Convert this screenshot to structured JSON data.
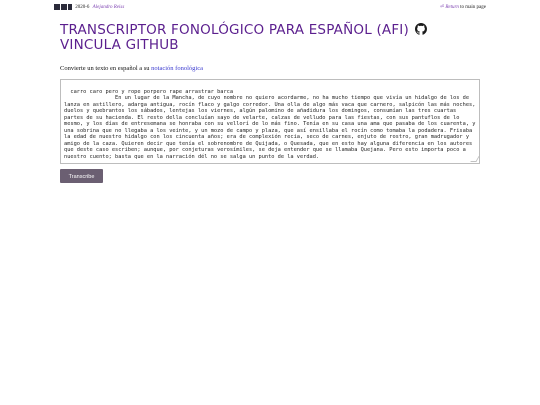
{
  "topbar": {
    "year": "2020-6",
    "author": "Alejandro Reiss",
    "back_arrow": "⏎",
    "back_label": "Return",
    "back_tail": "to main page"
  },
  "header": {
    "title": "Transcriptor fonológico para español (AFI)",
    "link_label": "vincula github"
  },
  "intro": {
    "text": "Convierte un texto en español a su",
    "link": "notación fonológica"
  },
  "input": {
    "value": "carro caro pero y rope porpero rape arrastrar barca\n                En un lugar de la Mancha, de cuyo nombre no quiero acordarme, no ha mucho tiempo que vivía un hidalgo de los de lanza en astillero, adarga antigua, rocín flaco y galgo corredor. Una olla de algo más vaca que carnero, salpicón las más noches, duelos y quebrantos los sábados, lentejas los viernes, algún palomino de añadidura los domingos, consumían las tres cuartas partes de su hacienda. El resto della concluían sayo de velarte, calzas de velludo para las fiestas, con sus pantuflos de lo mesmo, y los días de entresemana se honraba con su vellorí de lo más fino. Tenía en su casa una ama que pasaba de los cuarenta, y una sobrina que no llegaba a los veinte, y un mozo de campo y plaza, que así ensillaba el rocín como tomaba la podadera. Frisaba la edad de nuestro hidalgo con los cincuenta años; era de complexión recia, seco de carnes, enjuto de rostro, gran madrugador y amigo de la caza. Quieren decir que tenía el sobrenombre de Quijada, o Quesada, que en esto hay alguna diferencia en los autores que deste caso escriben; aunque, por conjeturas verosímiles, se deja entender que se llamaba Quejana. Pero esto importa poco a nuestro cuento; basta que en la narración dél no se salga un punto de la verdad."
  },
  "actions": {
    "submit_label": "Transcribe"
  },
  "colors": {
    "title": "#5b1f8e",
    "link": "#3a3acf",
    "button": "#6b5f72"
  }
}
